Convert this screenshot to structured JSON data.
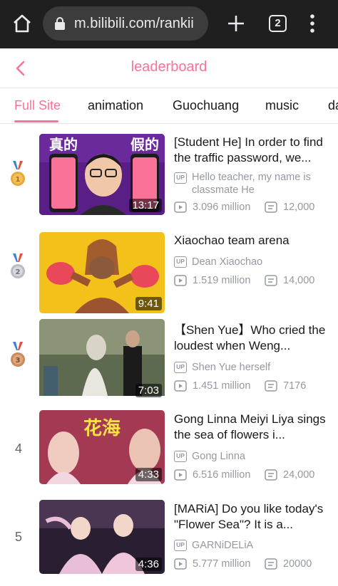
{
  "browser": {
    "url": "m.bilibili.com/rankii",
    "tab_count": "2"
  },
  "header": {
    "title": "leaderboard"
  },
  "categories": [
    {
      "label": "Full Site",
      "active": true
    },
    {
      "label": "animation",
      "active": false
    },
    {
      "label": "Guochuang",
      "active": false
    },
    {
      "label": "music",
      "active": false
    },
    {
      "label": "da",
      "active": false
    }
  ],
  "videos": [
    {
      "rank": "1",
      "title": "[Student He] In order to find the traffic password, we...",
      "uploader": "Hello teacher, my name is classmate He",
      "views": "3.096 million",
      "danmaku": "12,000",
      "duration": "13:17",
      "thumb_text": [
        "真的",
        "假的"
      ]
    },
    {
      "rank": "2",
      "title": "Xiaochao team arena",
      "uploader": "Dean Xiaochao",
      "views": "1.519 million",
      "danmaku": "14,000",
      "duration": "9:41"
    },
    {
      "rank": "3",
      "title": "【Shen Yue】Who cried the loudest when Weng...",
      "uploader": "Shen Yue herself",
      "views": "1.451 million",
      "danmaku": "7176",
      "duration": "7:03"
    },
    {
      "rank": "4",
      "title": "Gong Linna Meiyi Liya sings the sea of flowers i...",
      "uploader": "Gong Linna",
      "views": "6.516 million",
      "danmaku": "24,000",
      "duration": "4:33",
      "thumb_text": [
        "花海"
      ]
    },
    {
      "rank": "5",
      "title": "[MARiA] Do you like today's \"Flower Sea\"? It is a...",
      "uploader": "GARNiDELiA",
      "views": "5.777 million",
      "danmaku": "20000",
      "duration": "4:36"
    }
  ],
  "up_badge": "UP",
  "colors": {
    "accent": "#fb7299",
    "gold": "#e8a93a",
    "silver": "#b9bcc2",
    "bronze": "#c98a5c",
    "ribbon_blue": "#3f7fd6",
    "ribbon_red": "#e54d42"
  }
}
